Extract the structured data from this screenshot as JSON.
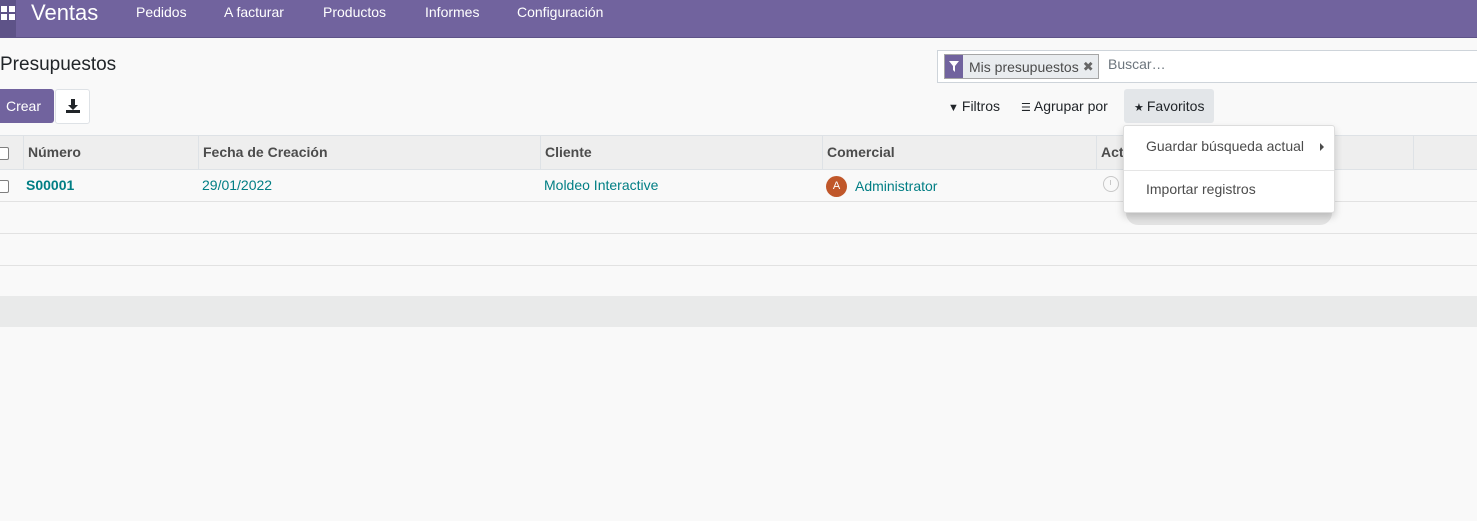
{
  "navbar": {
    "app_title": "Ventas",
    "menu": [
      "Pedidos",
      "A facturar",
      "Productos",
      "Informes",
      "Configuración"
    ],
    "color": "#71639e"
  },
  "control_panel": {
    "title": "Presupuestos",
    "create_label": "Crear",
    "download_icon": "download-icon"
  },
  "search": {
    "facet_label": "Mis presupuestos",
    "facet_icon": "filter-icon",
    "placeholder": "Buscar…",
    "filters_label": "Filtros",
    "groupby_label": "Agrupar por",
    "favorites_label": "Favoritos"
  },
  "favorites_menu": {
    "items": [
      "Guardar búsqueda actual",
      "Importar registros"
    ]
  },
  "table": {
    "columns": [
      "Número",
      "Fecha de Creación",
      "Cliente",
      "Comercial",
      "Act"
    ],
    "rows": [
      {
        "number": "S00001",
        "date": "29/01/2022",
        "customer": "Moldeo Interactive",
        "salesperson": "Administrator",
        "avatar_initial": "A"
      }
    ]
  }
}
